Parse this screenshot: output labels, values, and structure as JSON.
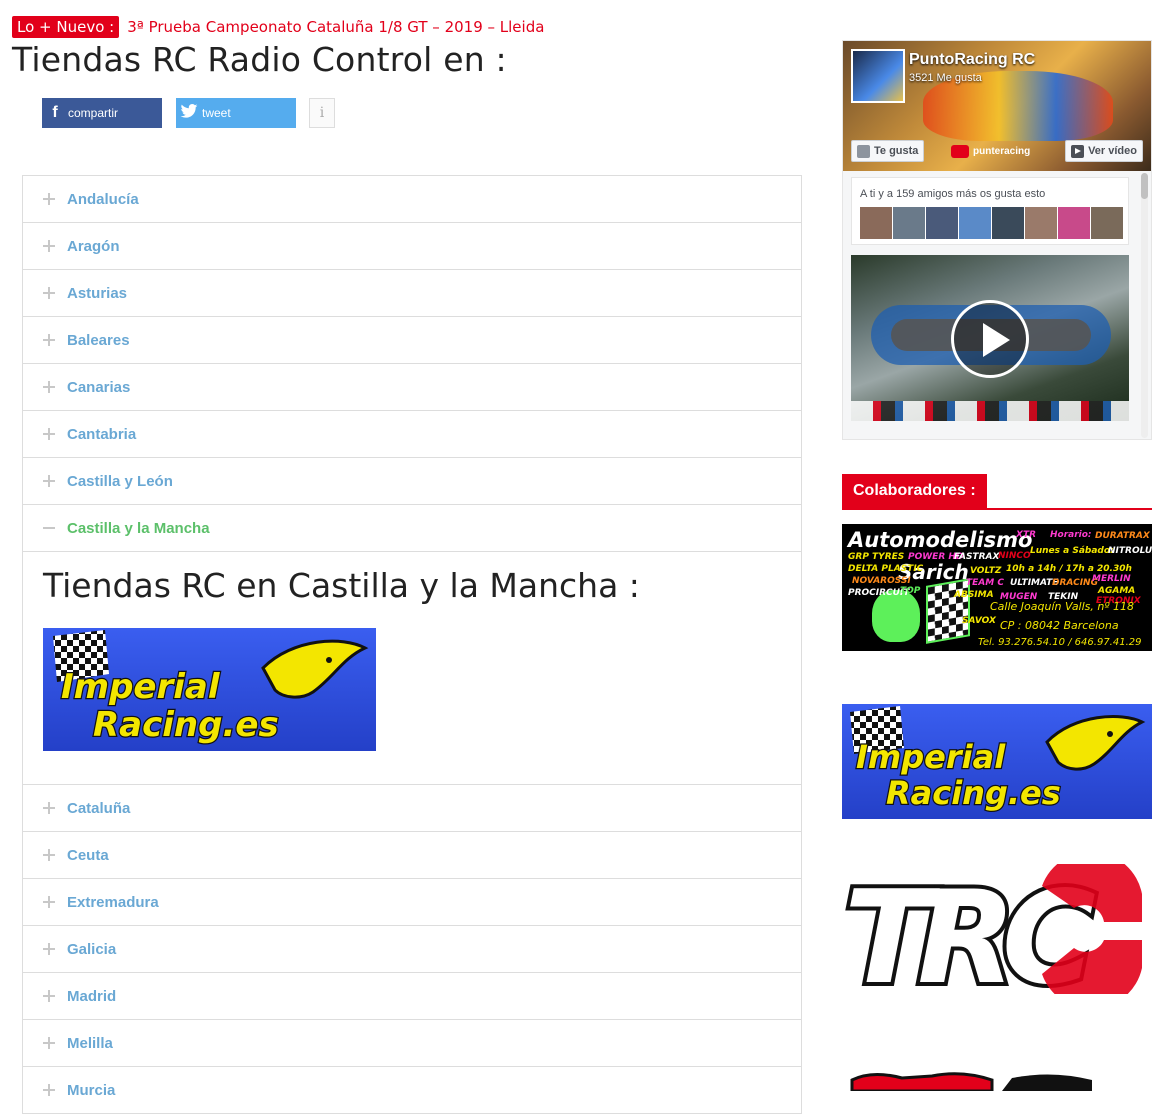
{
  "ticker": {
    "badge": "Lo + Nuevo :",
    "headline": "3ª Prueba Campeonato Cataluña 1/8 GT – 2019 – Lleida"
  },
  "page": {
    "title": "Tiendas RC Radio Control en :"
  },
  "share": {
    "facebook_label": "compartir",
    "twitter_label": "tweet",
    "info_label": "i"
  },
  "accordion": {
    "regions_before": [
      {
        "label": "Andalucía",
        "icon": "plus-icon"
      },
      {
        "label": "Aragón",
        "icon": "plus-icon"
      },
      {
        "label": "Asturias",
        "icon": "plus-icon"
      },
      {
        "label": "Baleares",
        "icon": "plus-icon"
      },
      {
        "label": "Canarias",
        "icon": "plus-icon"
      },
      {
        "label": "Cantabria",
        "icon": "plus-icon"
      },
      {
        "label": "Castilla y León",
        "icon": "plus-icon"
      }
    ],
    "active": {
      "label": "Castilla y la Mancha",
      "icon": "minus-icon",
      "panel_title": "Tiendas RC en Castilla y la Mancha :",
      "shop_logo": {
        "line1": "Imperial",
        "line2": "Racing.es"
      }
    },
    "regions_after": [
      {
        "label": "Cataluña",
        "icon": "plus-icon"
      },
      {
        "label": "Ceuta",
        "icon": "plus-icon"
      },
      {
        "label": "Extremadura",
        "icon": "plus-icon"
      },
      {
        "label": "Galicia",
        "icon": "plus-icon"
      },
      {
        "label": "Madrid",
        "icon": "plus-icon"
      },
      {
        "label": "Melilla",
        "icon": "plus-icon"
      },
      {
        "label": "Murcia",
        "icon": "plus-icon"
      }
    ],
    "colors": {
      "link": "#6aa8d4",
      "active": "#5cc06a",
      "sign": "#c8c8c8"
    }
  },
  "facebook_widget": {
    "page_name": "PuntoRacing RC",
    "likes": "3521 Me gusta",
    "like_button": "Te gusta",
    "video_button": "Ver vídeo",
    "channel": "punteracing",
    "friends_text": "A ti y a 159 amigos más os gusta esto"
  },
  "sidebar": {
    "collaborators_heading": "Colaboradores :",
    "sarich_ad": {
      "title": "Automodelismo",
      "name": "Sarich",
      "address": "Calle Joaquín Valls, nº 118",
      "postal": "CP : 08042  Barcelona",
      "phones": "Tel. 93.276.54.10 / 646.97.41.29",
      "brands": [
        "XTR",
        "Horario:",
        "DURATRAX",
        "GRP TYRES",
        "POWER HD",
        "FASTRAX",
        "NINCO",
        "Lunes a Sábado:",
        "NITROLUX",
        "DELTA PLASTIC",
        "VOLTZ",
        "10h a 14h / 17h a 20.30h",
        "NOVAROSSI",
        "TEAM C",
        "ULTIMATE",
        "DRACING",
        "MERLIN",
        "PROCIRCUIT",
        "TOP",
        "ABSIMA",
        "MUGEN",
        "TEKIN",
        "AGAMA",
        "ETRONIX",
        "SAVOX"
      ]
    },
    "imperial_logo": {
      "line1": "Imperial",
      "line2": "Racing.es"
    },
    "trc_logo": "TRC"
  },
  "brand_colors": {
    "accent_red": "#e2001a",
    "facebook_blue": "#3b5998",
    "twitter_blue": "#55acee",
    "imperial_blue": "#2d4fd8",
    "imperial_yellow": "#f3e600"
  }
}
